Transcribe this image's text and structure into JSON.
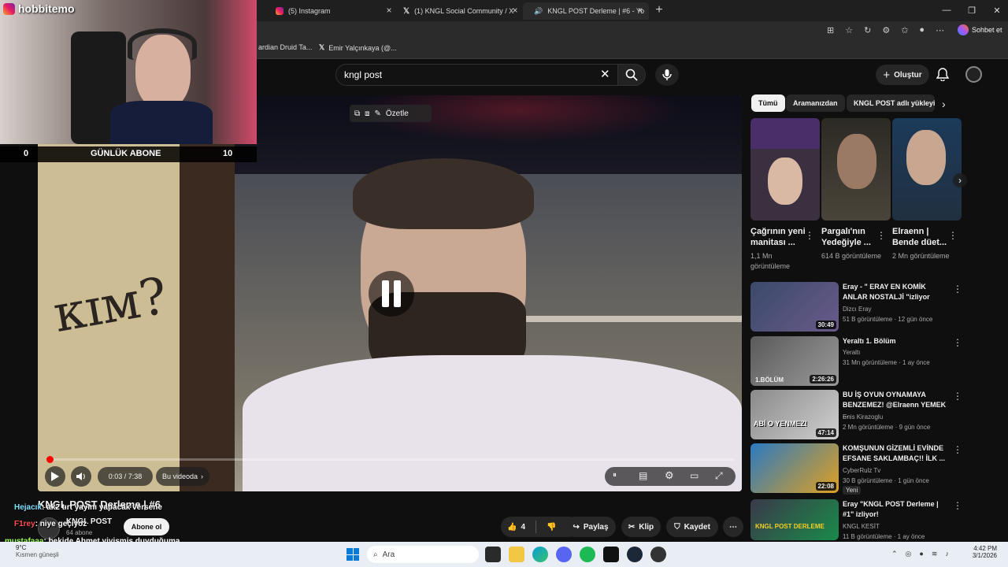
{
  "browser": {
    "tabs": [
      {
        "title": "(5) Instagram"
      },
      {
        "title": "(1) KNGL Social Community / X"
      },
      {
        "title": "KNGL POST Derleme | #6 - Yo"
      }
    ],
    "window_right": "Sohbet et",
    "bookmarks": [
      "ardian Druid Ta...",
      "Emir Yalçınkaya (@..."
    ]
  },
  "youtube": {
    "search_value": "kngl post",
    "create_label": "Oluştur",
    "player": {
      "summarize_label": "Özetle",
      "time": "0:03 / 7:38",
      "chapter_label": "Bu videoda",
      "progress_fraction": 0.004
    },
    "video": {
      "title": "KNGL POST Derleme | #6",
      "channel": "KNGL POST",
      "subscribers": "64 abone",
      "subscribe_label": "Abone ol",
      "likes": "4",
      "share_label": "Paylaş",
      "clip_label": "Klip",
      "save_label": "Kaydet"
    },
    "chips": [
      "Tümü",
      "Aramanızdan",
      "KNGL POST adlı yükleyi"
    ],
    "shorts": [
      {
        "title": "Çağrının yeni manitası ...",
        "views": "1,1 Mn görüntüleme"
      },
      {
        "title": "Pargalı'nın Yedeğiyle ...",
        "views": "614 B görüntüleme"
      },
      {
        "title": "Elraenn | Bende düet...",
        "views": "2 Mn görüntüleme"
      }
    ],
    "recommended": [
      {
        "title": "Eray - \" ERAY EN KOMİK ANLAR NOSTALJİ \"izliyor",
        "channel": "Dizcı Eray",
        "meta": "51 B görüntüleme · 12 gün önce",
        "duration": "30:49",
        "badge": ""
      },
      {
        "title": "Yeraltı 1. Bölüm",
        "channel": "Yeraltı",
        "meta": "31 Mn görüntüleme · 1 ay önce",
        "duration": "2:26:26",
        "badge": ""
      },
      {
        "title": "BU İŞ OYUN OYNAMAYA BENZEMEZ! @Elraenn YEMEK ...",
        "channel": "Enis Kirazoglu",
        "meta": "2 Mn görüntüleme · 9 gün önce",
        "duration": "47:14",
        "badge": ""
      },
      {
        "title": "KOMŞUNUN GİZEMLİ EVİNDE EFSANE SAKLAMBAÇ!! İLK ...",
        "channel": "CyberRulz Tv",
        "meta": "30 B görüntüleme · 1 gün önce",
        "duration": "22:08",
        "badge": "Yeni"
      },
      {
        "title": "Eray \"KNGL POST Derleme | #1\" izliyor!",
        "channel": "KNGL KESİT",
        "meta": "11 B görüntüleme · 1 ay önce",
        "duration": "",
        "badge": ""
      }
    ],
    "thumb_texts": {
      "yeralti": "1.BÖLÜM",
      "abi": "ABİ O YENMEZ!",
      "kngl": "KNGL POST DERLEME"
    }
  },
  "stream_overlay": {
    "streamer": "hobbitemo",
    "goal_left": "0",
    "goal_label": "GÜNLÜK ABONE",
    "goal_right": "10",
    "chat": [
      {
        "user": "Hejacık",
        "msg": ": ak2 tırt yayını yapacak versene",
        "color": "#7fe0ff"
      },
      {
        "user": "F1rey",
        "msg": ": niye geçiyoz",
        "color": "#ff4d4d"
      },
      {
        "user": "mustafaaa",
        "msg": ": bekide Ahmet yiyişmiş duyduğuma",
        "color": "#9cff57"
      }
    ]
  },
  "taskbar": {
    "search_placeholder": "Ara",
    "weather_temp": "9°C",
    "weather_desc": "Kısmen güneşli",
    "time": "4:42 PM",
    "date": "3/1/2026"
  }
}
